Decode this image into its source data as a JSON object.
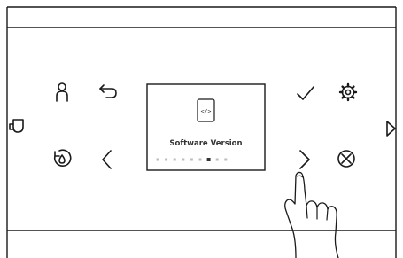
{
  "screen": {
    "icon": "code-file-icon",
    "icon_glyph": "</>",
    "label": "Software Version",
    "page_indicator": {
      "total": 9,
      "active": 7
    }
  },
  "buttons_left": [
    {
      "name": "profile-icon",
      "interactable": true
    },
    {
      "name": "back-arrow-icon",
      "interactable": true
    },
    {
      "name": "cup-icon",
      "interactable": true
    },
    {
      "name": "descale-icon",
      "interactable": true
    },
    {
      "name": "chevron-left-icon",
      "interactable": true
    }
  ],
  "buttons_right": [
    {
      "name": "checkmark-icon",
      "interactable": true
    },
    {
      "name": "gear-icon",
      "interactable": true
    },
    {
      "name": "play-triangle-icon",
      "interactable": true
    },
    {
      "name": "chevron-right-icon",
      "interactable": true
    },
    {
      "name": "cancel-circle-x-icon",
      "interactable": true
    }
  ],
  "annotation": {
    "name": "pointing-hand",
    "target": "chevron-right-icon"
  },
  "colors": {
    "stroke": "#1a1a1a",
    "dot_inactive": "#bdbdbd",
    "dot_active": "#333333",
    "screen_bg": "#ffffff"
  }
}
